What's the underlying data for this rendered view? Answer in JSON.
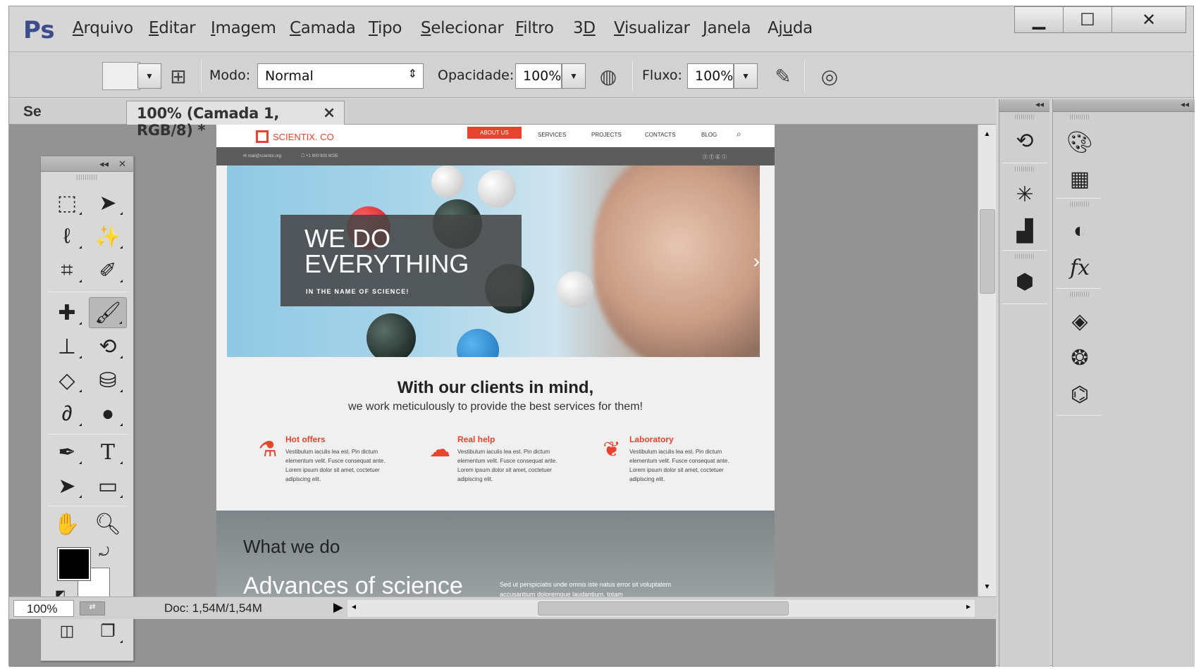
{
  "app": {
    "logo": "Ps",
    "menu": [
      {
        "pre": "",
        "u": "A",
        "post": "rquivo"
      },
      {
        "pre": "",
        "u": "E",
        "post": "ditar"
      },
      {
        "pre": "",
        "u": "I",
        "post": "magem"
      },
      {
        "pre": "",
        "u": "C",
        "post": "amada"
      },
      {
        "pre": "",
        "u": "T",
        "post": "ipo"
      },
      {
        "pre": "",
        "u": "S",
        "post": "elecionar"
      },
      {
        "pre": "",
        "u": "F",
        "post": "iltro"
      },
      {
        "pre": "3",
        "u": "D",
        "post": ""
      },
      {
        "pre": "",
        "u": "V",
        "post": "isualizar"
      },
      {
        "pre": "",
        "u": "J",
        "post": "anela"
      },
      {
        "pre": "Aj",
        "u": "u",
        "post": "da"
      }
    ],
    "window_buttons": {
      "minimize": "▁",
      "maximize": "☐",
      "close": "✕"
    }
  },
  "options": {
    "mode_label": "Modo:",
    "mode_value": "Normal",
    "opacity_label": "Opacidade:",
    "opacity_value": "100%",
    "flow_label": "Fluxo:",
    "flow_value": "100%"
  },
  "document": {
    "tab_prefix": "Se",
    "tab_title": "100% (Camada 1, RGB/8) *",
    "tab_close": "×"
  },
  "status": {
    "zoom": "100%",
    "doc_info": "Doc: 1,54M/1,54M"
  },
  "site": {
    "logo": "SCIENTIX. CO",
    "nav": [
      "ABOUT US",
      "SERVICES",
      "PROJECTS",
      "CONTACTS",
      "BLOG"
    ],
    "contact_email": "✉ mail@scientix.org",
    "contact_phone": "☐ +1 800 603 6035",
    "hero_title": "WE DO EVERYTHING",
    "hero_sub": "IN THE NAME OF SCIENCE!",
    "intro_heading": "With our clients in mind,",
    "intro_text": "we work meticulously to provide the best services for them!",
    "features": [
      {
        "title": "Hot offers",
        "text": "Vestibulum iaculis lea est. Pin dictum elementum velit. Fusce consequat ante. Lorem ipsum dolor sit amet, coctetuer adipiscing elit."
      },
      {
        "title": "Real help",
        "text": "Vestibulum iaculis lea est. Pin dictum elementum velit. Fusce consequat ante. Lorem ipsum dolor sit amet, coctetuer adipiscing elit."
      },
      {
        "title": "Laboratory",
        "text": "Vestibulum iaculis lea est. Pin dictum elementum velit. Fusce consequat ante. Lorem ipsum dolor sit amet, coctetuer adipiscing elit."
      }
    ],
    "what_heading": "What we do",
    "what_sub": "Advances of science",
    "what_text": "Sed ut perspiciatis unde omnis iste natus error sit voluptatem accusantium doloremque laudantium, totam"
  },
  "colors": {
    "accent": "#e8432e",
    "ps_blue": "#3d4d8c"
  }
}
